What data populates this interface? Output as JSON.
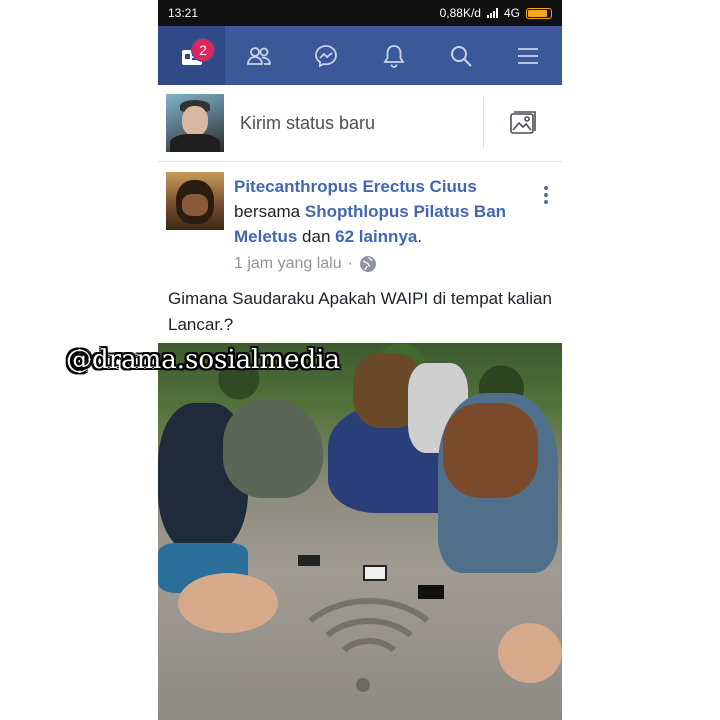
{
  "status_bar": {
    "time": "13:21",
    "network_speed": "0,88K/d",
    "network_type": "4G"
  },
  "nav": {
    "items": [
      {
        "icon": "news-feed-icon",
        "active": true
      },
      {
        "icon": "friends-icon"
      },
      {
        "icon": "messenger-icon"
      },
      {
        "icon": "bell-icon"
      },
      {
        "icon": "search-icon"
      },
      {
        "icon": "menu-icon"
      }
    ],
    "notification_count": "2"
  },
  "composer": {
    "placeholder": "Kirim status baru",
    "photo_icon": "photo-icon"
  },
  "post": {
    "author": "Pitecanthropus Erectus Ciuus",
    "with_word": "bersama",
    "tagged": "Shopthlopus Pilatus Ban Meletus",
    "and_word": "dan",
    "others": "62 lainnya",
    "period": ".",
    "time": "1 jam yang lalu",
    "separator": "·",
    "privacy_icon": "globe-icon",
    "caption": "Gimana Saudaraku Apakah WAIPI di tempat kalian Lancar.?"
  },
  "watermark": "@drama.sosialmedia",
  "colors": {
    "nav_bg": "#3b5998",
    "link": "#4267b2",
    "badge": "#e0245e"
  }
}
